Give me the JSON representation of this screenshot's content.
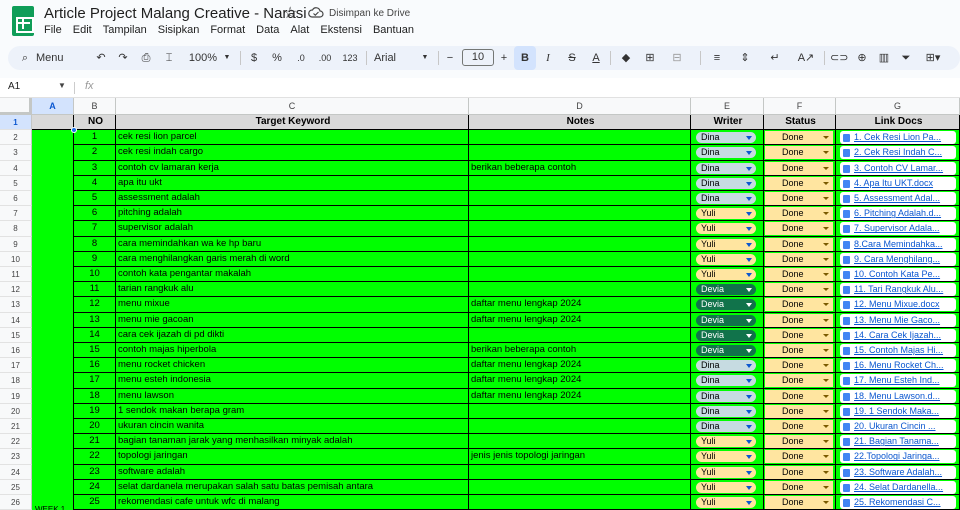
{
  "title": "Article Project Malang Creative - Narasi",
  "saved_status": "Disimpan ke Drive",
  "menu": [
    "File",
    "Edit",
    "Tampilan",
    "Sisipkan",
    "Format",
    "Data",
    "Alat",
    "Ekstensi",
    "Bantuan"
  ],
  "toolbar": {
    "search_label": "Menu",
    "zoom": "100%",
    "currency": "$",
    "percent": "%",
    "dec_decrease": ".0",
    "dec_increase": ".00",
    "number_format": "123",
    "font": "Arial",
    "font_size": "10"
  },
  "namebox": "A1",
  "fx": "fx",
  "columns": [
    "A",
    "B",
    "C",
    "D",
    "E",
    "F",
    "G"
  ],
  "headers": [
    "",
    "NO",
    "Target Keyword",
    "Notes",
    "Writer",
    "Status",
    "Link Docs"
  ],
  "rows": [
    {
      "no": "1",
      "kw": "cek resi lion parcel",
      "notes": "",
      "writer": "Dina",
      "status": "Done",
      "link": "1. Cek Resi Lion Pa..."
    },
    {
      "no": "2",
      "kw": "cek resi indah cargo",
      "notes": "",
      "writer": "Dina",
      "status": "Done",
      "link": "2. Cek Resi Indah C..."
    },
    {
      "no": "3",
      "kw": "contoh cv lamaran kerja",
      "notes": "berikan beberapa contoh",
      "writer": "Dina",
      "status": "Done",
      "link": "3. Contoh CV Lamar..."
    },
    {
      "no": "4",
      "kw": "apa itu ukt",
      "notes": "",
      "writer": "Dina",
      "status": "Done",
      "link": "4. Apa Itu UKT.docx"
    },
    {
      "no": "5",
      "kw": "assessment adalah",
      "notes": "",
      "writer": "Dina",
      "status": "Done",
      "link": "5. Assessment Adal..."
    },
    {
      "no": "6",
      "kw": "pitching adalah",
      "notes": "",
      "writer": "Yuli",
      "status": "Done",
      "link": "6. Pitching Adalah.d..."
    },
    {
      "no": "7",
      "kw": "supervisor adalah",
      "notes": "",
      "writer": "Yuli",
      "status": "Done",
      "link": "7. Supervisor Adala..."
    },
    {
      "no": "8",
      "kw": "cara memindahkan wa ke hp baru",
      "notes": "",
      "writer": "Yuli",
      "status": "Done",
      "link": "8.Cara Memindahka..."
    },
    {
      "no": "9",
      "kw": "cara menghilangkan garis merah di word",
      "notes": "",
      "writer": "Yuli",
      "status": "Done",
      "link": "9. Cara Menghilang..."
    },
    {
      "no": "10",
      "kw": "contoh kata pengantar makalah",
      "notes": "",
      "writer": "Yuli",
      "status": "Done",
      "link": "10. Contoh Kata Pe..."
    },
    {
      "no": "11",
      "kw": "tarian rangkuk alu",
      "notes": "",
      "writer": "Devia",
      "status": "Done",
      "link": "11. Tari Rangkuk Alu..."
    },
    {
      "no": "12",
      "kw": "menu mixue",
      "notes": "daftar menu lengkap 2024",
      "writer": "Devia",
      "status": "Done",
      "link": "12. Menu Mixue.docx"
    },
    {
      "no": "13",
      "kw": "menu mie gacoan",
      "notes": "daftar menu lengkap 2024",
      "writer": "Devia",
      "status": "Done",
      "link": "13. Menu Mie Gaco..."
    },
    {
      "no": "14",
      "kw": "cara cek ijazah di pd dikti",
      "notes": "",
      "writer": "Devia",
      "status": "Done",
      "link": "14. Cara Cek Ijazah..."
    },
    {
      "no": "15",
      "kw": "contoh majas hiperbola",
      "notes": "berikan beberapa contoh",
      "writer": "Devia",
      "status": "Done",
      "link": "15. Contoh Majas Hi..."
    },
    {
      "no": "16",
      "kw": "menu rocket chicken",
      "notes": "daftar menu lengkap 2024",
      "writer": "Dina",
      "status": "Done",
      "link": "16. Menu Rocket Ch..."
    },
    {
      "no": "17",
      "kw": "menu esteh indonesia",
      "notes": "daftar menu lengkap 2024",
      "writer": "Dina",
      "status": "Done",
      "link": "17. Menu Esteh Ind..."
    },
    {
      "no": "18",
      "kw": "menu lawson",
      "notes": "daftar menu lengkap 2024",
      "writer": "Dina",
      "status": "Done",
      "link": "18. Menu Lawson.d..."
    },
    {
      "no": "19",
      "kw": "1 sendok makan berapa gram",
      "notes": "",
      "writer": "Dina",
      "status": "Done",
      "link": "19. 1 Sendok Maka..."
    },
    {
      "no": "20",
      "kw": "ukuran cincin wanita",
      "notes": "",
      "writer": "Dina",
      "status": "Done",
      "link": "20. Ukuran Cincin ..."
    },
    {
      "no": "21",
      "kw": "bagian tanaman jarak yang menhasilkan minyak adalah",
      "notes": "",
      "writer": "Yuli",
      "status": "Done",
      "link": "21. Bagian Tanama..."
    },
    {
      "no": "22",
      "kw": "topologi jaringan",
      "notes": "jenis jenis topologi jaringan",
      "writer": "Yuli",
      "status": "Done",
      "link": "22.Topologi Jaringa..."
    },
    {
      "no": "23",
      "kw": "software adalah",
      "notes": "",
      "writer": "Yuli",
      "status": "Done",
      "link": "23. Software Adalah..."
    },
    {
      "no": "24",
      "kw": "selat dardanela merupakan salah satu batas pemisah antara",
      "notes": "",
      "writer": "Yuli",
      "status": "Done",
      "link": "24. Selat Dardanella..."
    },
    {
      "no": "25",
      "kw": "rekomendasi cafe untuk wfc di malang",
      "notes": "",
      "writer": "Yuli",
      "status": "Done",
      "link": "25. Rekomendasi C..."
    }
  ],
  "week_label": "WEEK 1"
}
